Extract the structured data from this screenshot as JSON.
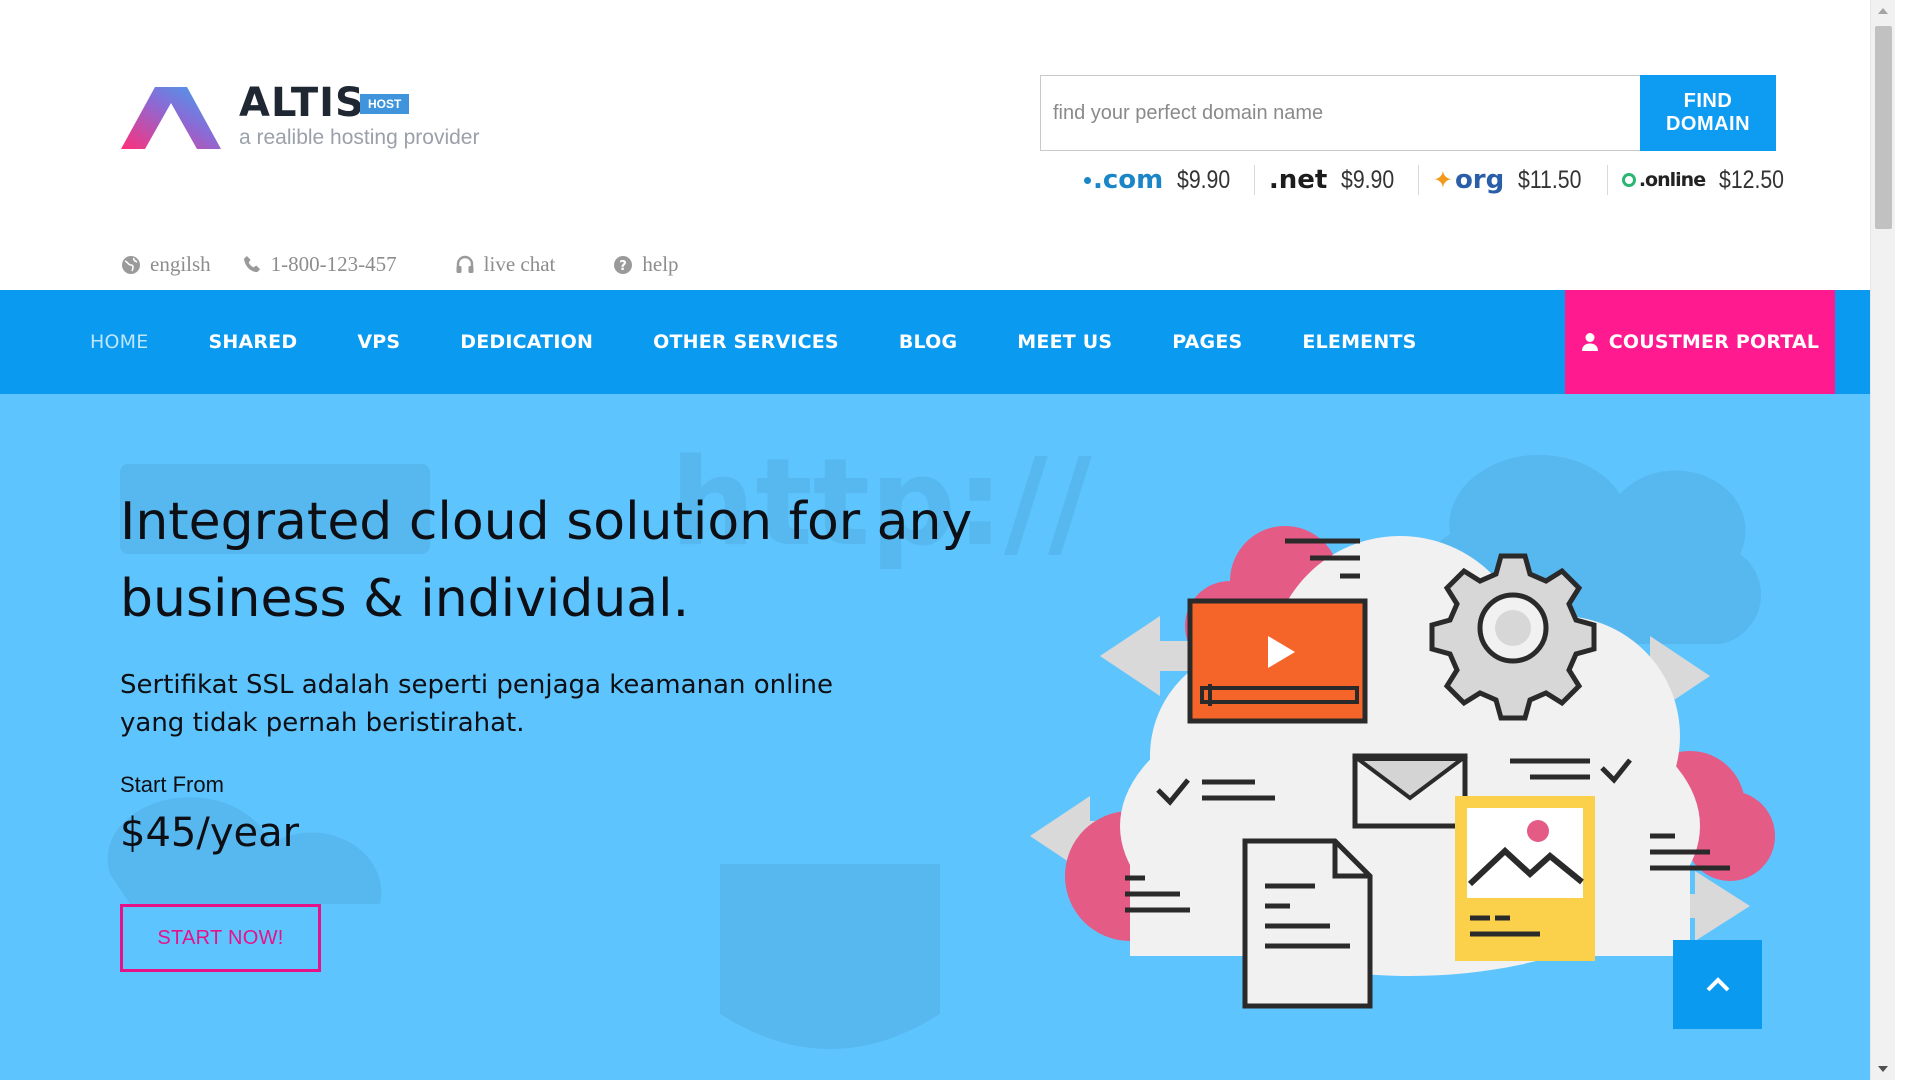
{
  "brand": {
    "name": "ALTIS",
    "badge": "HOST",
    "tagline": "a realible hosting provider"
  },
  "domain_search": {
    "placeholder": "find your perfect domain name",
    "button_label": "FIND DOMAIN",
    "tlds": [
      {
        "name": ".com",
        "price": "$9.90",
        "color": "#1a86c8"
      },
      {
        "name": ".net",
        "price": "$9.90",
        "color": "#1c1c1c"
      },
      {
        "name": "org",
        "price": "$11.50",
        "color": "#2a5ea8"
      },
      {
        "name": ".online",
        "price": "$12.50",
        "color": "#222222"
      }
    ]
  },
  "topbar": {
    "language": "engilsh",
    "phone": "1-800-123-457",
    "chat": "live chat",
    "help": "help"
  },
  "nav": {
    "items": [
      "HOME",
      "SHARED",
      "VPS",
      "DEDICATION",
      "OTHER SERVICES",
      "BLOG",
      "MEET US",
      "PAGES",
      "ELEMENTS"
    ],
    "active": "HOME",
    "portal_label": "COUSTMER PORTAL"
  },
  "hero": {
    "title": "Integrated cloud solution for any business & individual.",
    "subtitle": "Sertifikat SSL adalah seperti penjaga keamanan online yang tidak pernah beristirahat.",
    "start_from": "Start From",
    "price": "$45/year",
    "cta": "START NOW!"
  },
  "colors": {
    "nav_bg": "#0a9aef",
    "portal_bg": "#ff1a8f",
    "hero_bg": "#5ec4fd",
    "cta": "#e6128a"
  }
}
